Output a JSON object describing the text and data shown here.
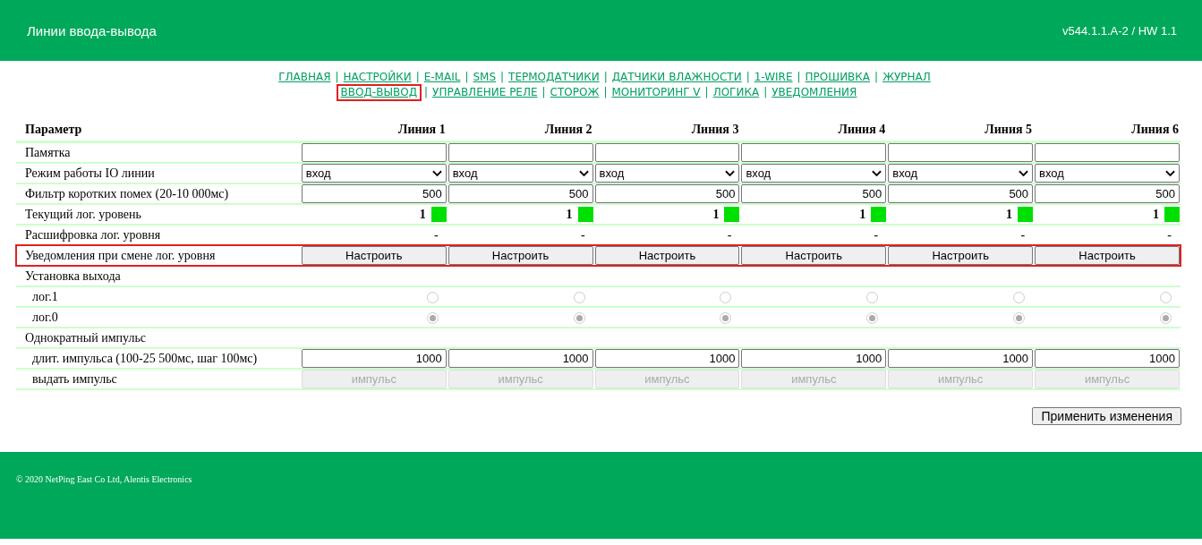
{
  "header": {
    "title": "Линии ввода-вывода",
    "version": "v544.1.1.A-2 / HW 1.1"
  },
  "nav_separator": "|",
  "nav": [
    [
      {
        "label": "ГЛАВНАЯ",
        "selected": false
      },
      {
        "label": "НАСТРОЙКИ",
        "selected": false
      },
      {
        "label": "E-MAIL",
        "selected": false
      },
      {
        "label": "SMS",
        "selected": false
      },
      {
        "label": "ТЕРМОДАТЧИКИ",
        "selected": false
      },
      {
        "label": "ДАТЧИКИ ВЛАЖНОСТИ",
        "selected": false
      },
      {
        "label": "1-WIRE",
        "selected": false
      },
      {
        "label": "ПРОШИВКА",
        "selected": false
      },
      {
        "label": "ЖУРНАЛ",
        "selected": false
      }
    ],
    [
      {
        "label": "ВВОД-ВЫВОД",
        "selected": true
      },
      {
        "label": "УПРАВЛЕНИЕ РЕЛЕ",
        "selected": false
      },
      {
        "label": "СТОРОЖ",
        "selected": false
      },
      {
        "label": "МОНИТОРИНГ V",
        "selected": false
      },
      {
        "label": "ЛОГИКА",
        "selected": false
      },
      {
        "label": "УВЕДОМЛЕНИЯ",
        "selected": false
      }
    ]
  ],
  "table": {
    "columns": [
      "Параметр",
      "Линия 1",
      "Линия 2",
      "Линия 3",
      "Линия 4",
      "Линия 5",
      "Линия 6"
    ],
    "rows": [
      {
        "kind": "input",
        "label": "Памятка"
      },
      {
        "kind": "select",
        "label": "Режим работы IO линии",
        "values": [
          "вход",
          "вход",
          "вход",
          "вход",
          "вход",
          "вход"
        ]
      },
      {
        "kind": "number",
        "label": "Фильтр коротких помех (20-10 000мс)",
        "values": [
          "500",
          "500",
          "500",
          "500",
          "500",
          "500"
        ]
      },
      {
        "kind": "level",
        "label": "Текущий лог. уровень",
        "cells": [
          {
            "value": "1",
            "color": "#00e000"
          },
          {
            "value": "1",
            "color": "#00e000"
          },
          {
            "value": "1",
            "color": "#00e000"
          },
          {
            "value": "1",
            "color": "#00e000"
          },
          {
            "value": "1",
            "color": "#00e000"
          },
          {
            "value": "1",
            "color": "#00e000"
          }
        ]
      },
      {
        "kind": "plain",
        "label": "Расшифровка лог. уровня",
        "values": [
          "-",
          "-",
          "-",
          "-",
          "-",
          "-"
        ]
      },
      {
        "kind": "button",
        "label": "Уведомления при смене лог. уровня",
        "highlighted": true,
        "disabled": false,
        "values": [
          "Настроить",
          "Настроить",
          "Настроить",
          "Настроить",
          "Настроить",
          "Настроить"
        ]
      },
      {
        "kind": "section",
        "label": "Установка выхода",
        "children": [
          {
            "kind": "radio",
            "label": "лог.1",
            "disabled": true,
            "cells": [
              {
                "selected": false
              },
              {
                "selected": false
              },
              {
                "selected": false
              },
              {
                "selected": false
              },
              {
                "selected": false
              },
              {
                "selected": false
              }
            ]
          },
          {
            "kind": "radio",
            "label": "лог.0",
            "disabled": true,
            "cells": [
              {
                "selected": true
              },
              {
                "selected": true
              },
              {
                "selected": true
              },
              {
                "selected": true
              },
              {
                "selected": true
              },
              {
                "selected": true
              }
            ]
          }
        ]
      },
      {
        "kind": "section",
        "label": "Однократный импульс",
        "children": [
          {
            "kind": "number",
            "label": "длит. импульса (100-25 500мс, шаг 100мс)",
            "values": [
              "1000",
              "1000",
              "1000",
              "1000",
              "1000",
              "1000"
            ]
          },
          {
            "kind": "button",
            "label": "выдать импульс",
            "disabled": true,
            "values": [
              "импульс",
              "импульс",
              "импульс",
              "импульс",
              "импульс",
              "импульс"
            ]
          }
        ]
      }
    ]
  },
  "apply_button": "Применить изменения",
  "footer": "© 2020 NetPing East Co Ltd, Alentis Electronics"
}
